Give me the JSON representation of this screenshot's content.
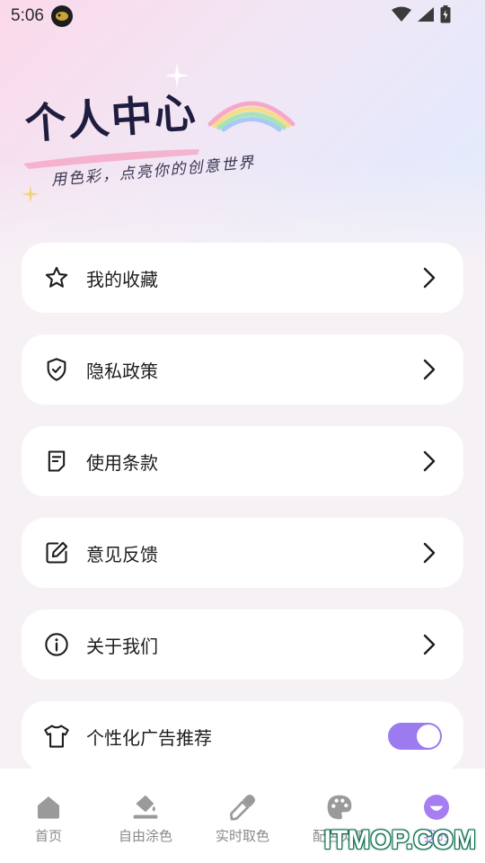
{
  "status_bar": {
    "time": "5:06"
  },
  "hero": {
    "title": "个人中心",
    "subtitle": "用色彩，点亮你的创意世界"
  },
  "menu": {
    "items": [
      {
        "label": "我的收藏",
        "icon": "star-icon"
      },
      {
        "label": "隐私政策",
        "icon": "shield-check-icon"
      },
      {
        "label": "使用条款",
        "icon": "document-icon"
      },
      {
        "label": "意见反馈",
        "icon": "edit-icon"
      },
      {
        "label": "关于我们",
        "icon": "info-icon"
      }
    ],
    "ad_toggle": {
      "label": "个性化广告推荐",
      "icon": "tshirt-icon",
      "enabled": true
    }
  },
  "bottom_nav": {
    "items": [
      {
        "label": "首页",
        "icon": "home-icon"
      },
      {
        "label": "自由涂色",
        "icon": "paint-bucket-icon"
      },
      {
        "label": "实时取色",
        "icon": "eyedropper-icon"
      },
      {
        "label": "配色灵感",
        "icon": "palette-icon"
      },
      {
        "label": "我的",
        "icon": "profile-icon",
        "active": true
      }
    ]
  },
  "watermark": "ITMOP.COM",
  "colors": {
    "accent": "#a77ef1",
    "toggle": "#9b7bef",
    "title": "#1f1d3f"
  }
}
